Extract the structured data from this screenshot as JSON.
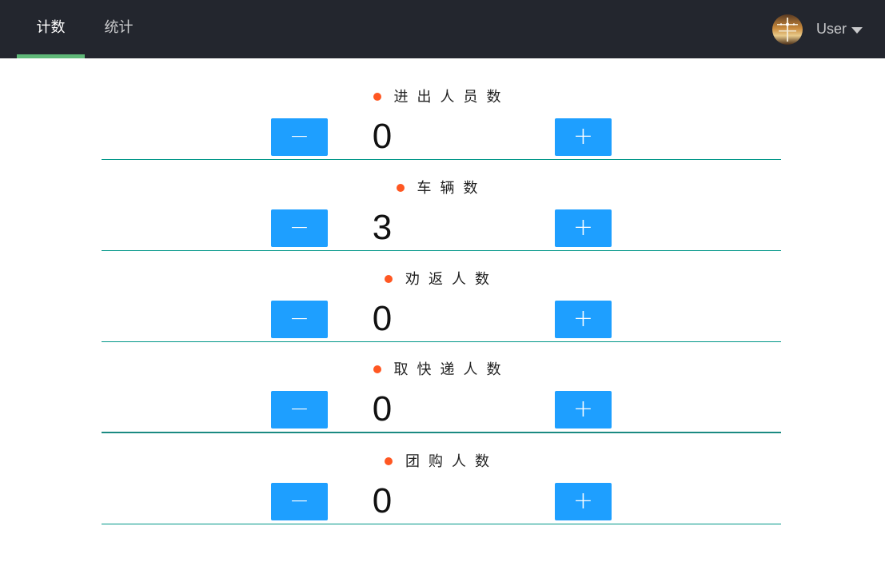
{
  "nav": {
    "tabs": [
      {
        "label": "计数",
        "active": true
      },
      {
        "label": "统计",
        "active": false
      }
    ],
    "user": {
      "name": "User",
      "avatar_icon": "avatar-image"
    }
  },
  "controls": {
    "minus_label": "−",
    "plus_label": "+"
  },
  "counters": [
    {
      "title": "进出人员数",
      "value": "0"
    },
    {
      "title": "车辆数",
      "value": "3"
    },
    {
      "title": "劝返人数",
      "value": "0"
    },
    {
      "title": "取快递人数",
      "value": "0"
    },
    {
      "title": "团购人数",
      "value": "0"
    }
  ],
  "colors": {
    "nav_bg": "#23262e",
    "active_tab_underline": "#5fb878",
    "button": "#1e9fff",
    "dot": "#ff5722",
    "divider": "#009688"
  }
}
